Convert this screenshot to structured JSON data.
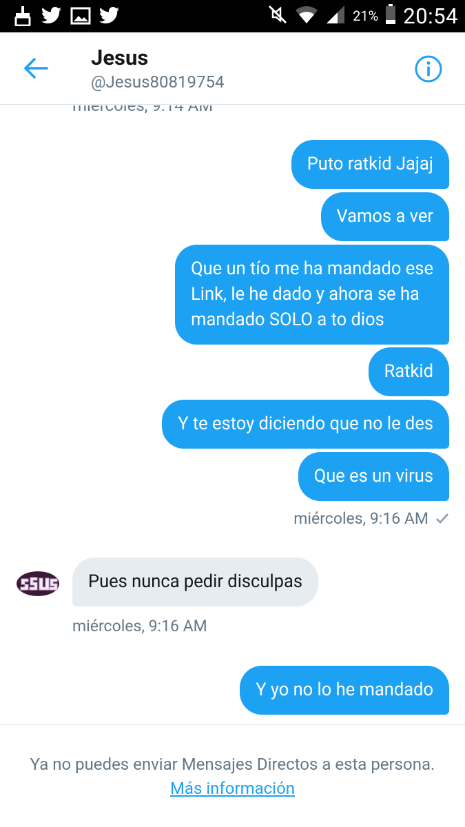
{
  "status_bar": {
    "battery_percent": "21%",
    "time": "20:54",
    "icons": [
      "broom-icon",
      "twitter-bird-icon",
      "gallery-icon",
      "twitter-bird-icon",
      "mute-icon",
      "wifi-icon",
      "signal-icon",
      "battery-icon"
    ]
  },
  "header": {
    "name": "Jesus",
    "handle": "@Jesus80819754",
    "back_icon": "arrow-left-icon",
    "info_icon": "info-icon"
  },
  "conversation": {
    "cut_timestamp": "miércoles, 9:14 AM",
    "messages_out_1": [
      "Puto ratkid Jajaj",
      "Vamos a ver",
      "Que un tío me ha mandado ese\nLink, le he dado y ahora se ha\nmandado SOLO a to dios",
      "Ratkid",
      "Y te estoy diciendo que no le des",
      "Que es un virus"
    ],
    "out_timestamp": "miércoles, 9:16 AM",
    "in_message": "Pues nunca pedir disculpas",
    "in_timestamp": "miércoles, 9:16 AM",
    "messages_out_2": [
      "Y yo no lo he mandado"
    ]
  },
  "footer": {
    "notice": "Ya no puedes enviar Mensajes Directos a esta persona. ",
    "link": "Más información"
  },
  "colors": {
    "accent": "#1da1f2",
    "incoming_bubble": "#e6ecf0",
    "secondary_text": "#657786"
  }
}
